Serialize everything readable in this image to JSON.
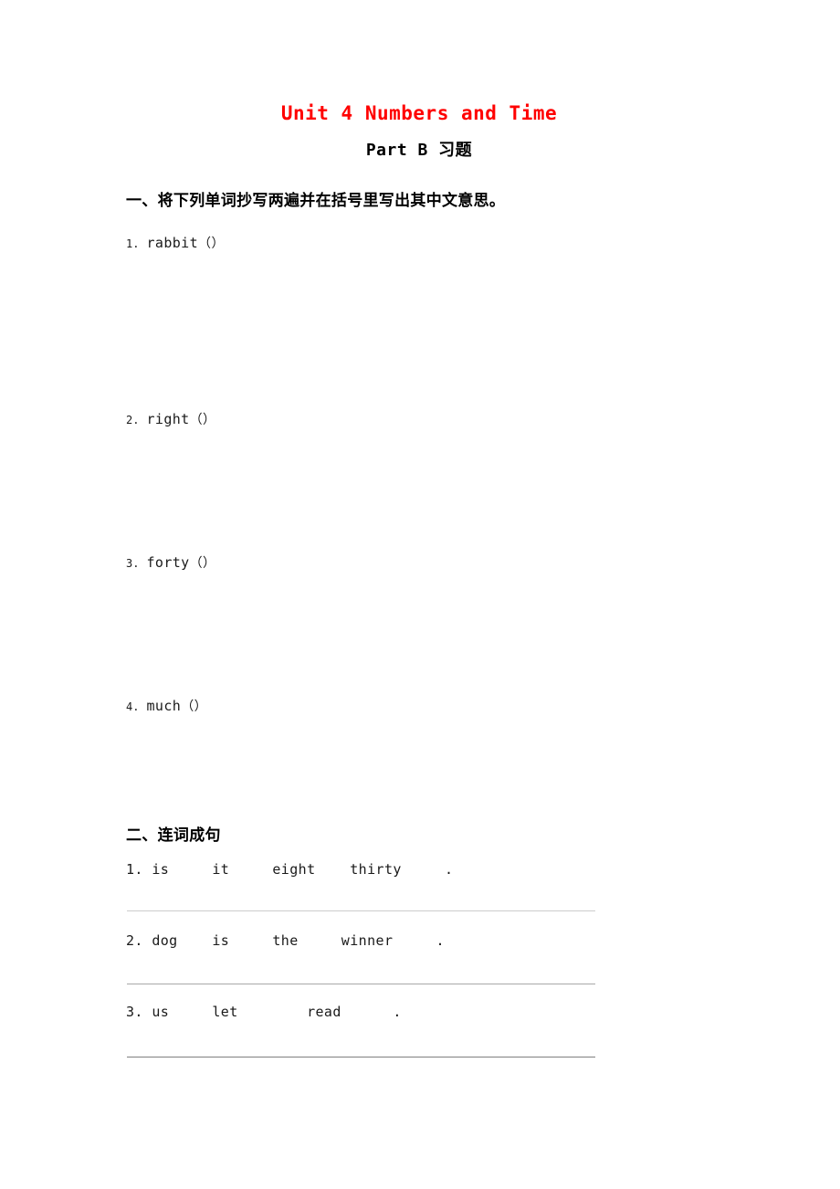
{
  "document": {
    "title": "Unit 4 Numbers and Time",
    "subtitle": "Part B 习题",
    "title_color": "#ff0000",
    "body_color": "#1a1a1a",
    "page_background": "#ffffff"
  },
  "sections": [
    {
      "id": "section-one",
      "heading": "一、将下列单词抄写两遍并在括号里写出其中文意思。",
      "items": [
        {
          "num": "1.",
          "word": "rabbit",
          "paren": "（）"
        },
        {
          "num": "2.",
          "word": "right",
          "paren": "（）"
        },
        {
          "num": "3.",
          "word": "forty",
          "paren": "（）"
        },
        {
          "num": "4.",
          "word": "much",
          "paren": "（）"
        }
      ]
    },
    {
      "id": "section-two",
      "heading": "二、连词成句",
      "items": [
        {
          "num": "1.",
          "text": "is     it     eight    thirty     .",
          "line_color": "#cccccc"
        },
        {
          "num": "2.",
          "text": "dog    is     the     winner     .",
          "line_color": "#a8a8a8"
        },
        {
          "num": "3.",
          "text": "us     let        read      .",
          "line_color": "#808080"
        }
      ]
    }
  ]
}
